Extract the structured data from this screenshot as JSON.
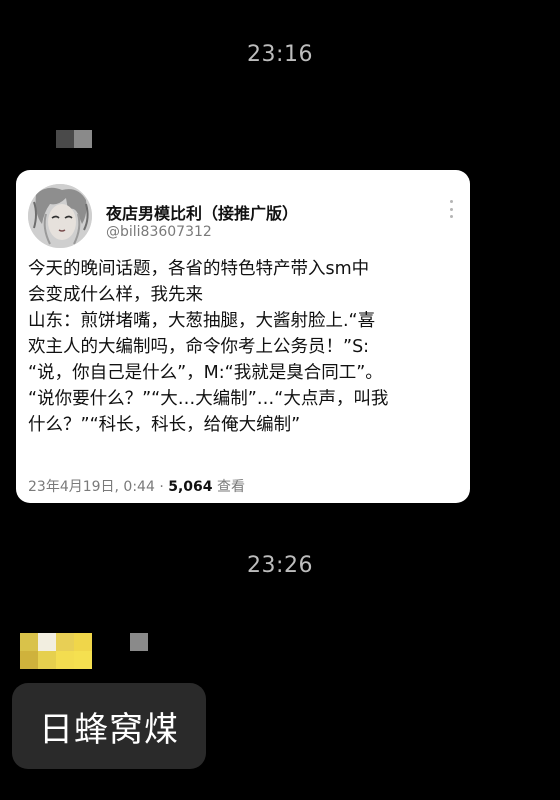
{
  "timestamps": [
    "23:16",
    "23:26"
  ],
  "shared_post": {
    "display_name": "夜店男模比利（接推广版）",
    "handle": "@bili83607312",
    "text_lines": [
      "今天的晚间话题，各省的特色特产带入sm中",
      "会变成什么样，我先来",
      "山东：煎饼堵嘴，大葱抽腿，大酱射脸上.“喜",
      "欢主人的大编制吗，命令你考上公务员！”S:",
      "“说，你自己是什么”，M:“我就是臭合同工”。",
      "“说你要什么？”“大…大编制”…“大点声，叫我",
      "什么？”“科长，科长，给俺大编制”"
    ],
    "date": "23年4月19日, 0:44 ·",
    "views": "5,064",
    "views_label": "查看"
  },
  "reply_message": {
    "text": "日蜂窝煤"
  },
  "colors": {
    "background": "#000000",
    "bubble": "#2a2a2a",
    "card": "#ffffff",
    "timestamp": "#bdbdbd",
    "handle": "#7a7a7a"
  },
  "icons": {
    "more": "more-vertical-icon",
    "avatar": "avatar"
  }
}
